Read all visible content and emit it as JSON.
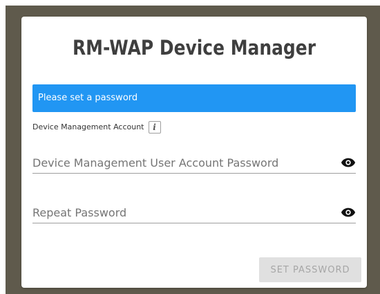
{
  "app": {
    "title": "RM-WAP Device Manager"
  },
  "notice": {
    "text": "Please set a password",
    "color": "#2196f3"
  },
  "account": {
    "label": "Device Management Account",
    "info_icon": "info-icon",
    "info_glyph": "i"
  },
  "fields": {
    "password": {
      "placeholder": "Device Management User Account Password",
      "value": "",
      "toggle_icon": "eye-icon"
    },
    "repeat": {
      "placeholder": "Repeat Password",
      "value": "",
      "toggle_icon": "eye-icon"
    }
  },
  "actions": {
    "submit_label": "SET PASSWORD",
    "submit_enabled": false
  },
  "colors": {
    "background": "#5f5a4c",
    "card": "#ffffff",
    "title": "#3f3f3f",
    "button_disabled_bg": "#e0e0e0",
    "button_disabled_text": "#a6a6a6"
  }
}
